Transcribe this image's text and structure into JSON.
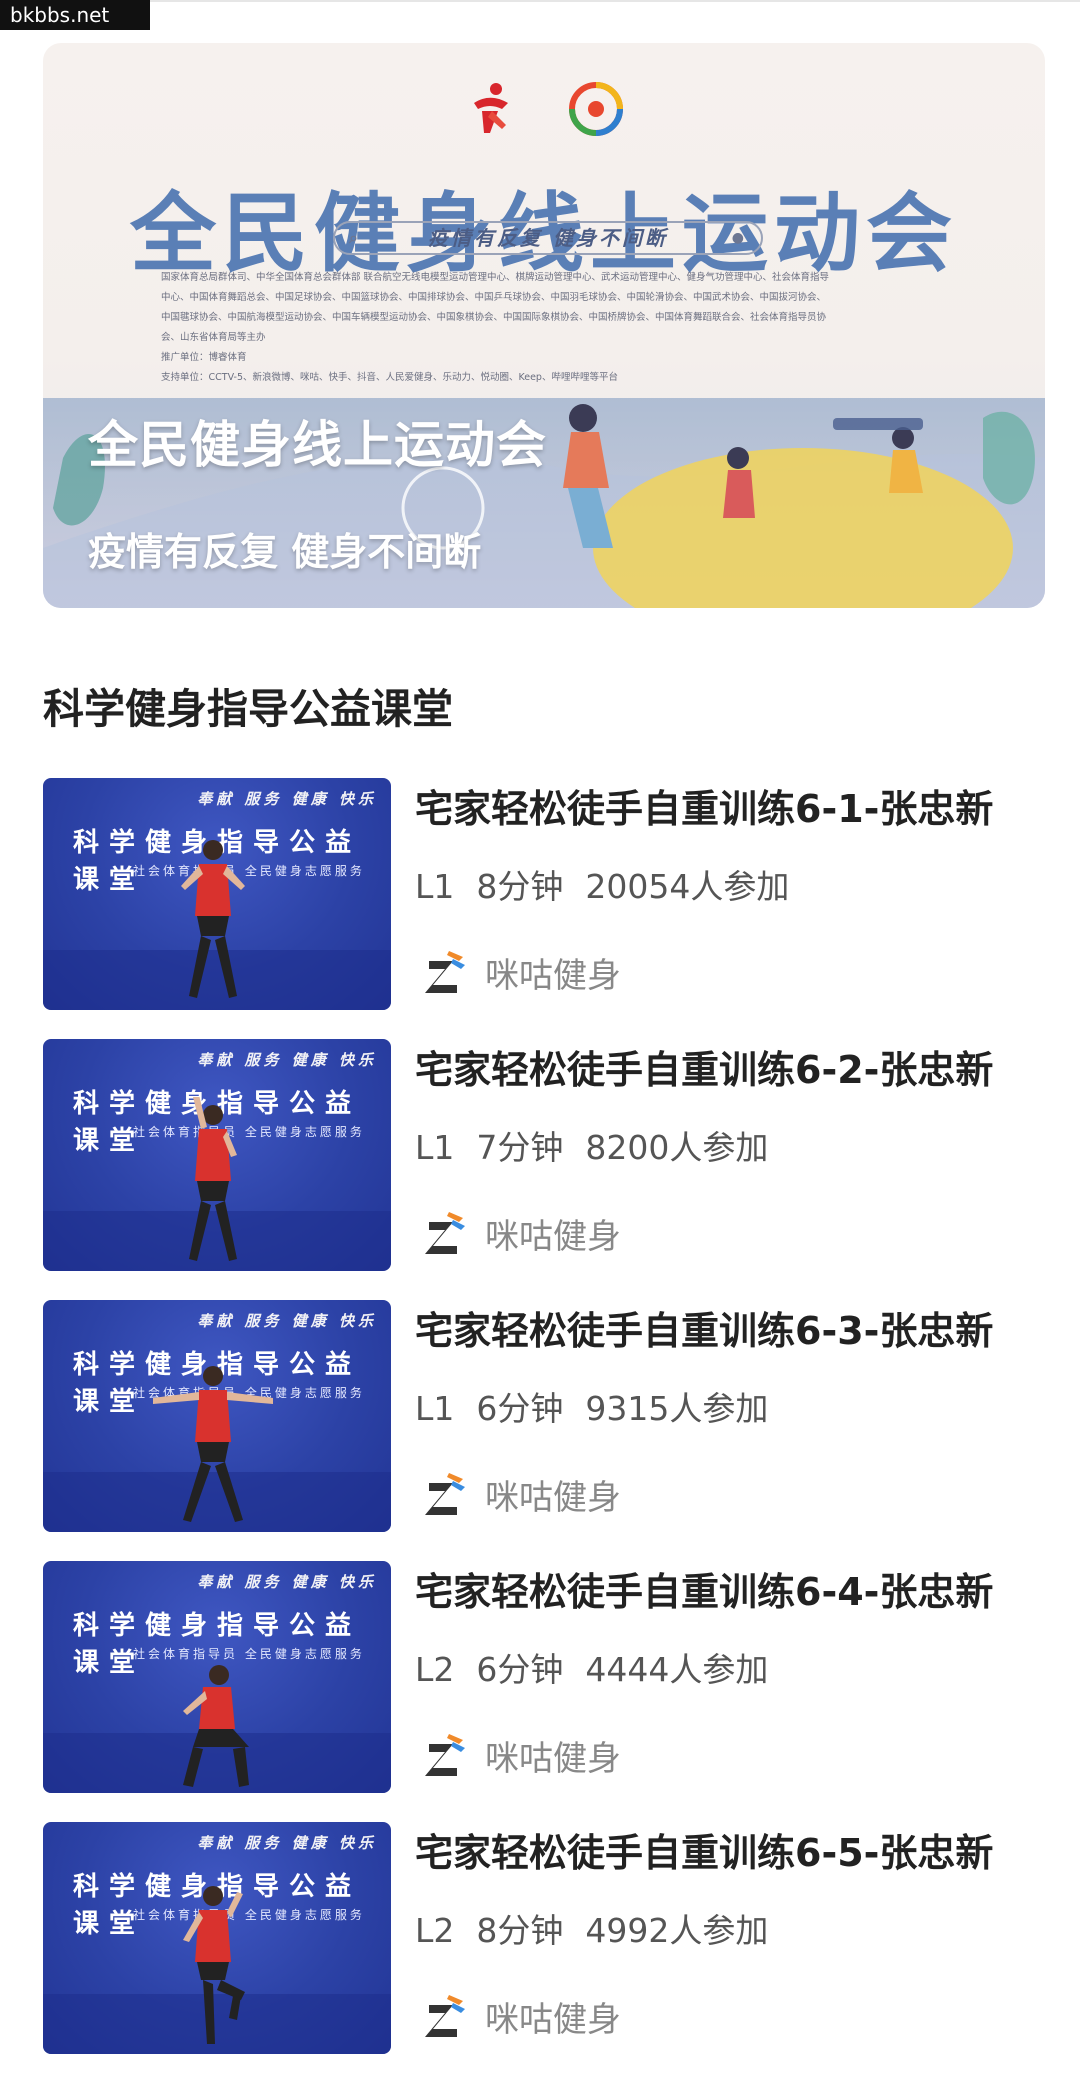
{
  "watermark": "bkbbs.net",
  "banner": {
    "big_title": "全民健身线上运动会",
    "pill_text": "疫情有反复  健身不间断",
    "fine_print": [
      "国家体育总局群体司、中华全国体育总会群体部 联合航空无线电模型运动管理中心、棋牌运动管理中心、武术运动管理中心、健身气功管理中心、社会体育指导",
      "中心、中国体育舞蹈总会、中国足球协会、中国篮球协会、中国排球协会、中国乒乓球协会、中国羽毛球协会、中国轮滑协会、中国武术协会、中国拔河协会、",
      "中国毽球协会、中国航海模型运动协会、中国车辆模型运动协会、中国象棋协会、中国国际象棋协会、中国桥牌协会、中国体育舞蹈联合会、社会体育指导员协",
      "会、山东省体育局等主办",
      "推广单位：博睿体育",
      "支持单位：CCTV-5、新浪微博、咪咕、快手、抖音、人民爱健身、乐动力、悦动圈、Keep、哔哩哔哩等平台"
    ],
    "overlay_title": "全民健身线上运动会",
    "overlay_subtitle": "疫情有反复 健身不间断"
  },
  "section": {
    "title": "科学健身指导公益课堂"
  },
  "thumb_text": {
    "slogan": "奉献 服务 健康 快乐",
    "title": "科学健身指导公益课堂",
    "sub": "社会体育指导员 全民健身志愿服务"
  },
  "courses": [
    {
      "name": "宅家轻松徒手自重训练6-1-张忠新",
      "level": "L1",
      "duration": "8分钟",
      "participants": "20054人参加",
      "source": "咪咕健身",
      "pose": "stand"
    },
    {
      "name": "宅家轻松徒手自重训练6-2-张忠新",
      "level": "L1",
      "duration": "7分钟",
      "participants": "8200人参加",
      "source": "咪咕健身",
      "pose": "arm-up"
    },
    {
      "name": "宅家轻松徒手自重训练6-3-张忠新",
      "level": "L1",
      "duration": "6分钟",
      "participants": "9315人参加",
      "source": "咪咕健身",
      "pose": "arms-out"
    },
    {
      "name": "宅家轻松徒手自重训练6-4-张忠新",
      "level": "L2",
      "duration": "6分钟",
      "participants": "4444人参加",
      "source": "咪咕健身",
      "pose": "squat"
    },
    {
      "name": "宅家轻松徒手自重训练6-5-张忠新",
      "level": "L2",
      "duration": "8分钟",
      "participants": "4992人参加",
      "source": "咪咕健身",
      "pose": "knee-up"
    }
  ]
}
